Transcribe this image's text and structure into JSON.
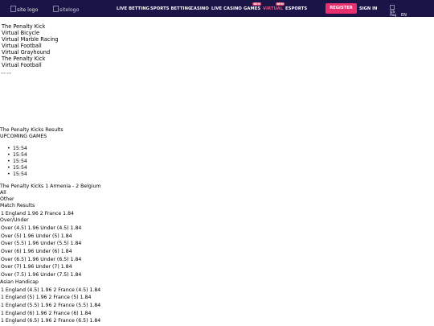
{
  "header": {
    "logo_alt": "site logo",
    "logo2_alt": "sitelogo",
    "nav": [
      {
        "label": "LIVE BETTING"
      },
      {
        "label": "SPORTS BETTING"
      },
      {
        "label": "CASINO"
      },
      {
        "label": "LIVE CASINO"
      },
      {
        "label": "GAMES",
        "badge": "NEW"
      },
      {
        "label": "VIRTUAL",
        "badge": "NEW",
        "active": true
      },
      {
        "label": "ESPORTS"
      }
    ],
    "register_label": "REGISTER",
    "signin_label": "SIGN IN",
    "lang_flag_alt": "US flag",
    "lang_code": "EN",
    "accent_color": "#e8306e",
    "bar_color": "#1b1446"
  },
  "games": [
    "The Penalty Kick",
    "Virtual Bicycle",
    "Virtual Marble Racing",
    "Virtual Football",
    "Virtual Grayhound",
    "The Penalty Kick",
    "Virtual Football"
  ],
  "arrows_text": "<< >>",
  "results_title": "The Penalty Kicks Results",
  "upcoming_title": "UPCOMING GAMES",
  "upcoming_times": [
    "15:54",
    "15:54",
    "15:54",
    "15:54",
    "15:54"
  ],
  "match_title": "The Penalty Kicks 1 Armenia - 2 Belgium",
  "filter_all": "All",
  "filter_other": "Other",
  "match_results_label": "Match Results",
  "match_results_row": "1 England 1.96 2 France 1.84",
  "over_under_label": "Over/Under",
  "over_under_rows": [
    "Over (4.5) 1.96 Under (4.5) 1.84",
    "Over (5) 1.96    Under (5) 1.84",
    "Over (5.5) 1.96 Under (5.5) 1.84",
    "Over (6) 1.96    Under (6) 1.84",
    "Over (6.5) 1.96 Under (6.5) 1.84",
    "Over (7) 1.96    Under (7) 1.84",
    "Over (7.5) 1.96 Under (7.5) 1.84"
  ],
  "asian_label": "Asian Handicap",
  "asian_rows": [
    "1 England (4.5) 1.96 2 France (4.5) 1.84",
    "1 England (5) 1.96    2 France (5) 1.84",
    "1 England (5.5) 1.96 2 France (5.5) 1.84",
    "1 England (6) 1.96    2 France (6) 1.84",
    "1 England (6.5) 1.96 2 France (6.5) 1.84"
  ]
}
